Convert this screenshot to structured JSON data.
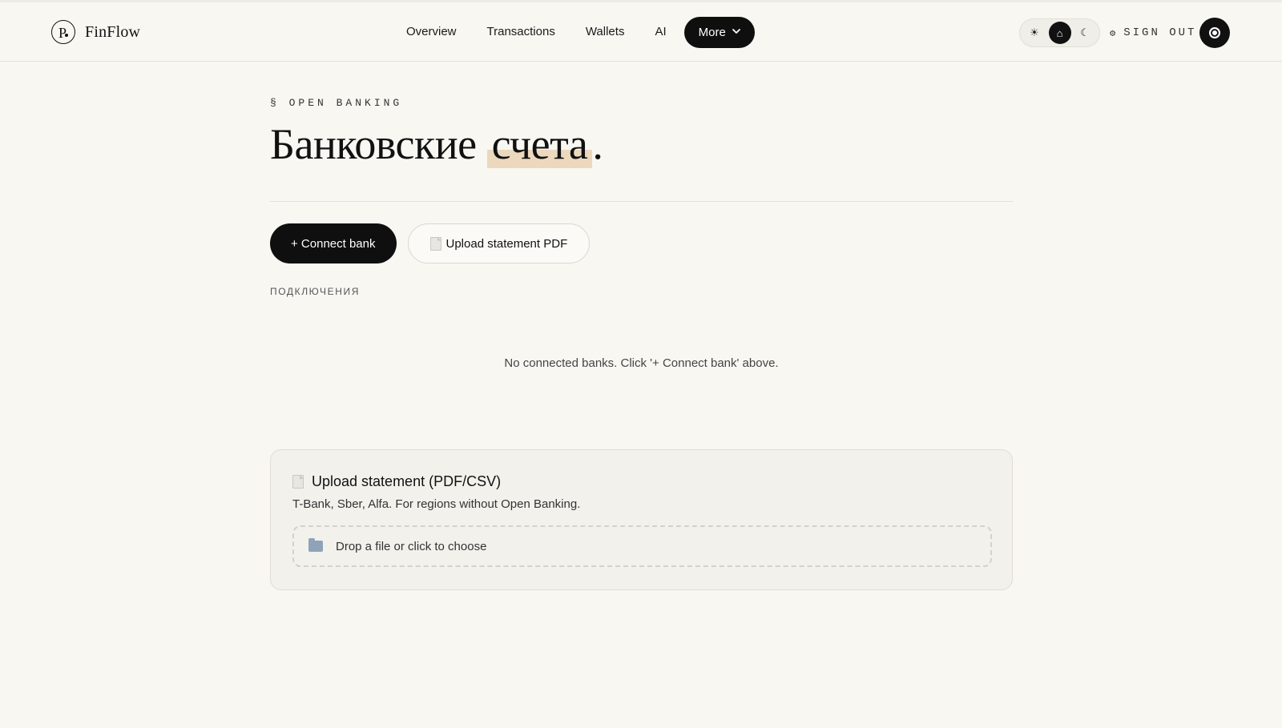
{
  "brand": {
    "name": "FinFlow",
    "logo_icon": "finflow-logo-icon",
    "logo_letter": "P"
  },
  "nav": {
    "items": [
      {
        "label": "Overview"
      },
      {
        "label": "Transactions"
      },
      {
        "label": "Wallets"
      },
      {
        "label": "AI"
      }
    ],
    "more_label": "More",
    "more_icon": "chevron-down-icon"
  },
  "theme_toggle": {
    "options": [
      {
        "name": "light",
        "icon": "sun-icon",
        "glyph": "☀",
        "active": false
      },
      {
        "name": "system",
        "icon": "home-icon",
        "glyph": "⌂",
        "active": true
      },
      {
        "name": "dark",
        "icon": "moon-icon",
        "glyph": "☾",
        "active": false
      }
    ]
  },
  "account": {
    "sign_out_label": "SIGN OUT",
    "settings_glyph": "⚙"
  },
  "page": {
    "eyebrow": "§ OPEN BANKING",
    "title_main": "Банковские",
    "title_highlight": "счета",
    "title_end": ".",
    "highlight_color": "#ecd8bd"
  },
  "actions": {
    "connect_label": "+ Connect bank",
    "upload_label": "Upload statement PDF"
  },
  "connections": {
    "section_label": "ПОДКЛЮЧЕНИЯ",
    "empty_text": "No connected banks. Click '+ Connect bank' above."
  },
  "upload_card": {
    "title": "Upload statement (PDF/CSV)",
    "subtitle": "T-Bank, Sber, Alfa. For regions without Open Banking.",
    "dropzone_label": "Drop a file or click to choose"
  },
  "colors": {
    "background": "#f8f7f2",
    "primary": "#0f0f0f",
    "accent": "#ecd8bd"
  }
}
